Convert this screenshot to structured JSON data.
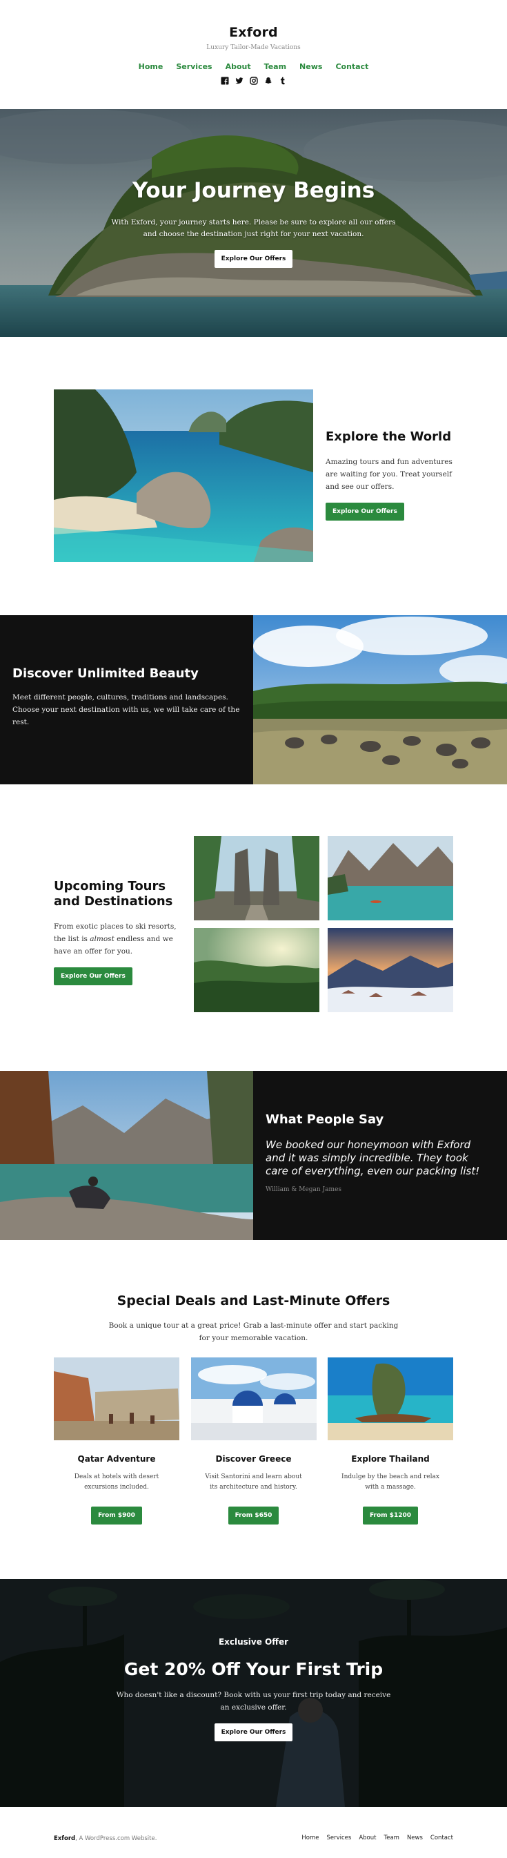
{
  "header": {
    "site_title": "Exford",
    "tagline": "Luxury Tailor-Made Vacations",
    "nav": [
      "Home",
      "Services",
      "About",
      "Team",
      "News",
      "Contact"
    ],
    "social_icons": [
      "facebook-icon",
      "twitter-icon",
      "instagram-icon",
      "snapchat-icon",
      "tumblr-icon"
    ]
  },
  "hero": {
    "title": "Your Journey Begins",
    "text": "With Exford, your journey starts here. Please be sure to explore all our offers and choose the destination just right for your next vacation.",
    "button": "Explore Our Offers"
  },
  "explore": {
    "title": "Explore the World",
    "text": "Amazing tours and fun adventures are waiting for you. Treat yourself and see our offers.",
    "button": "Explore Our Offers"
  },
  "beauty": {
    "title": "Discover Unlimited Beauty",
    "text": "Meet different people, cultures, traditions and landscapes. Choose your next destination with us, we will take care of the rest."
  },
  "upcoming": {
    "title": "Upcoming Tours and Destinations",
    "text_before": "From exotic places to ski resorts, the list is ",
    "text_em": "almost",
    "text_after": " endless and we have an offer for you.",
    "button": "Explore Our Offers"
  },
  "testimonial": {
    "title": "What People Say",
    "quote": "We booked our honeymoon with Exford and it was simply incredible. They took care of everything, even our packing list!",
    "author": "William & Megan James"
  },
  "deals": {
    "title": "Special Deals and Last-Minute Offers",
    "text": "Book a unique tour at a great price! Grab a last-minute offer and start packing for your memorable vacation.",
    "cards": [
      {
        "title": "Qatar Adventure",
        "text": "Deals at hotels with desert excursions included.",
        "button": "From $900"
      },
      {
        "title": "Discover Greece",
        "text": "Visit Santorini and learn about its architecture and history.",
        "button": "From $650"
      },
      {
        "title": "Explore Thailand",
        "text": "Indulge by the beach and relax with a massage.",
        "button": "From $1200"
      }
    ]
  },
  "offer": {
    "kicker": "Exclusive Offer",
    "title": "Get 20% Off Your First Trip",
    "text": "Who doesn't like a discount? Book with us your first trip today and receive an exclusive offer.",
    "button": "Explore Our Offers"
  },
  "footer": {
    "site_name": "Exford",
    "credit": ", A WordPress.com Website.",
    "nav": [
      "Home",
      "Services",
      "About",
      "Team",
      "News",
      "Contact"
    ]
  },
  "colors": {
    "accent": "#2b8a3e",
    "dark": "#111111"
  }
}
